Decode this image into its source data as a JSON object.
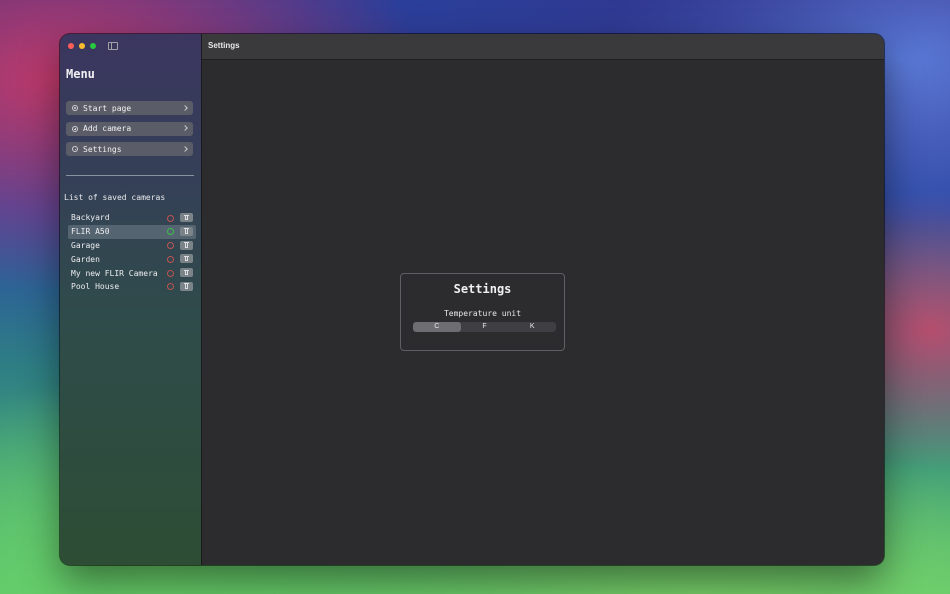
{
  "window": {
    "title": "Settings"
  },
  "sidebar": {
    "title": "Menu",
    "nav": [
      {
        "label": "Start page",
        "icon": "home-icon"
      },
      {
        "label": "Add camera",
        "icon": "plus-circle-icon"
      },
      {
        "label": "Settings",
        "icon": "gear-icon"
      }
    ],
    "cameras_title": "List of saved cameras",
    "cameras": [
      {
        "name": "Backyard",
        "connected": false,
        "selected": false
      },
      {
        "name": "FLIR A50",
        "connected": true,
        "selected": true
      },
      {
        "name": "Garage",
        "connected": false,
        "selected": false
      },
      {
        "name": "Garden",
        "connected": false,
        "selected": false
      },
      {
        "name": "My new FLIR Camera",
        "connected": false,
        "selected": false
      },
      {
        "name": "Pool House",
        "connected": false,
        "selected": false
      }
    ]
  },
  "settings": {
    "title": "Settings",
    "temperature_label": "Temperature unit",
    "units": [
      "C",
      "F",
      "K"
    ],
    "selected_unit": "C"
  },
  "colors": {
    "connected": "#3dbf4b",
    "disconnected": "#c0544f"
  }
}
